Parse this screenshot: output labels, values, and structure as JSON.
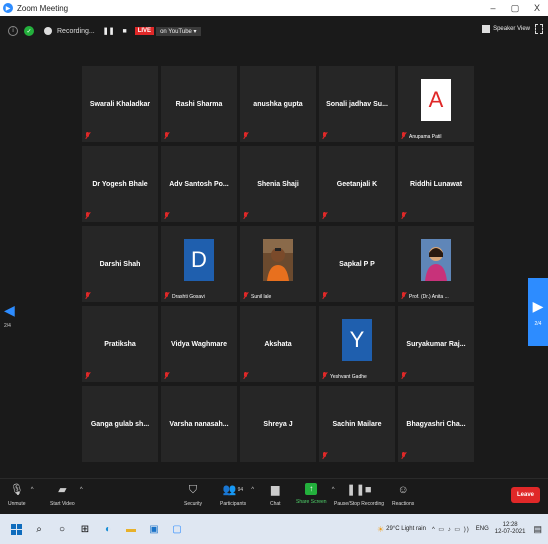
{
  "window": {
    "title": "Zoom Meeting",
    "minimize": "–",
    "maximize": "▢",
    "close": "X"
  },
  "topbar": {
    "recording_label": "Recording...",
    "pause_label": "❚❚",
    "stop_label": "■",
    "live_label": "LIVE",
    "youtube_label": "on YouTube ▾",
    "speaker_view_label": "Speaker View"
  },
  "gallery": {
    "page_indicator_left": "2/4",
    "page_indicator_right": "2/4",
    "participants": [
      {
        "name": "Swarali Khaladkar",
        "muted": true
      },
      {
        "name": "Rashi Sharma",
        "muted": true
      },
      {
        "name": "anushka gupta",
        "muted": true
      },
      {
        "name": "Sonali jadhav Su...",
        "muted": true
      },
      {
        "name": "",
        "tag": "Anupama Patil",
        "avatar_letter": "A",
        "avatar_bg": "#ffffff",
        "avatar_fg": "#e02828",
        "muted": true
      },
      {
        "name": "Dr Yogesh Bhale",
        "muted": true
      },
      {
        "name": "Adv Santosh Po...",
        "muted": true
      },
      {
        "name": "Shenia Shaji",
        "muted": true
      },
      {
        "name": "Geetanjali K",
        "muted": true
      },
      {
        "name": "Riddhi Lunawat",
        "muted": true
      },
      {
        "name": "Darshi Shah",
        "muted": true
      },
      {
        "name": "",
        "tag": "Drashti Gosavi",
        "avatar_letter": "D",
        "avatar_bg": "#1f5fae",
        "avatar_fg": "#ffffff",
        "muted": true
      },
      {
        "name": "",
        "tag": "Sunil lale",
        "photo": "man",
        "muted": true
      },
      {
        "name": "Sapkal P P",
        "muted": true
      },
      {
        "name": "",
        "tag": "Prof. (Dr.) Anita ...",
        "photo": "woman",
        "muted": true
      },
      {
        "name": "Pratiksha",
        "muted": true
      },
      {
        "name": "Vidya Waghmare",
        "muted": true
      },
      {
        "name": "Akshata",
        "muted": true
      },
      {
        "name": "",
        "tag": "Yeshvant Gadhe",
        "avatar_letter": "Y",
        "avatar_bg": "#1f5fae",
        "avatar_fg": "#ffffff",
        "muted": true
      },
      {
        "name": "Suryakumar Raj...",
        "muted": true
      },
      {
        "name": "Ganga gulab sh...",
        "muted": false
      },
      {
        "name": "Varsha nanasah...",
        "muted": false
      },
      {
        "name": "Shreya J",
        "muted": false
      },
      {
        "name": "Sachin Mailare",
        "muted": true
      },
      {
        "name": "Bhagyashri Cha...",
        "muted": true
      }
    ]
  },
  "toolbar": {
    "unmute": "Unmute",
    "start_video": "Start Video",
    "security": "Security",
    "participants": "Participants",
    "participants_count": "94",
    "chat": "Chat",
    "share_screen": "Share Screen",
    "recording": "Pause/Stop Recording",
    "reactions": "Reactions",
    "leave": "Leave"
  },
  "taskbar": {
    "weather": "29°C  Light rain",
    "language": "ENG",
    "time": "12:28",
    "date": "12-07-2021"
  },
  "colors": {
    "accent": "#2d8cff",
    "danger": "#e02828",
    "success": "#23b03c",
    "tile_bg": "#262626"
  }
}
